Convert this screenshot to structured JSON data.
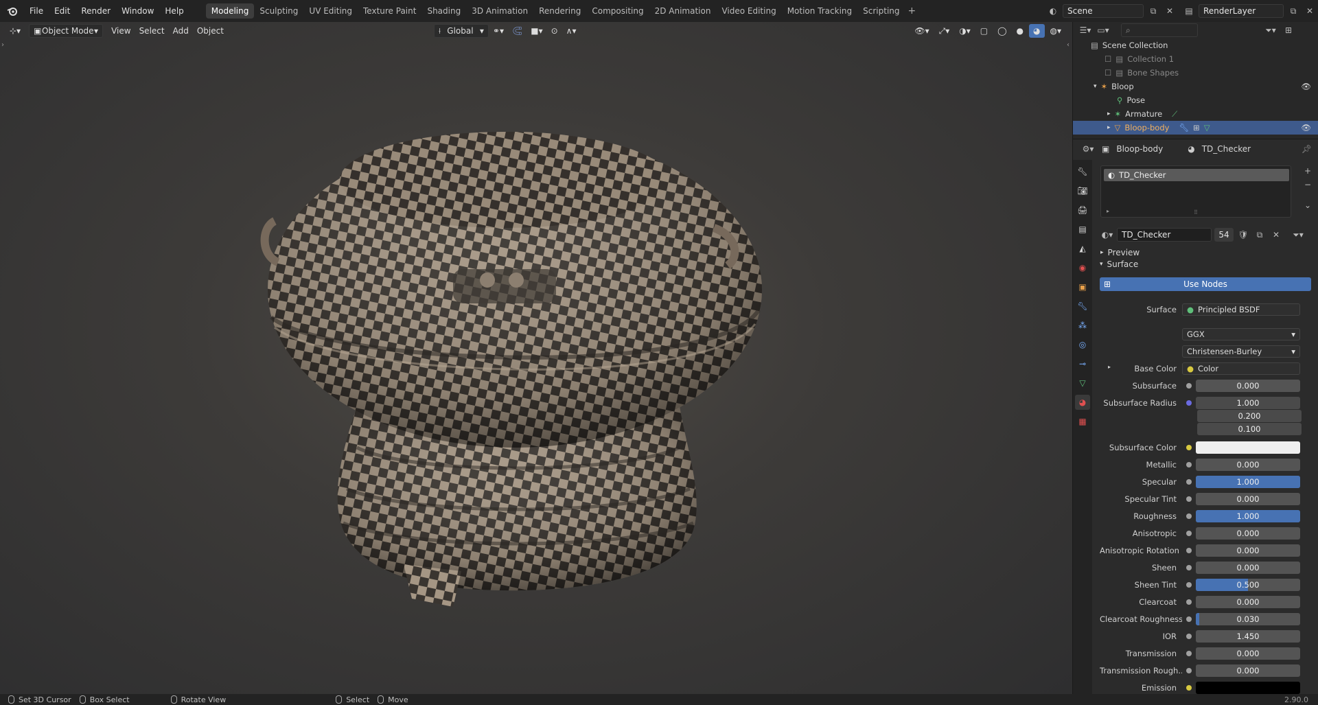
{
  "menu": [
    "File",
    "Edit",
    "Render",
    "Window",
    "Help"
  ],
  "workspaces": [
    "Modeling",
    "Sculpting",
    "UV Editing",
    "Texture Paint",
    "Shading",
    "3D Animation",
    "Rendering",
    "Compositing",
    "2D Animation",
    "Video Editing",
    "Motion Tracking",
    "Scripting"
  ],
  "active_workspace": "Modeling",
  "scene_name": "Scene",
  "view_layer": "RenderLayer",
  "viewport": {
    "mode": "Object Mode",
    "menus": [
      "View",
      "Select",
      "Add",
      "Object"
    ],
    "transform_orientation": "Global"
  },
  "outliner": {
    "root": "Scene Collection",
    "items": [
      {
        "label": "Collection 1"
      },
      {
        "label": "Bone Shapes"
      },
      {
        "label": "Bloop"
      },
      {
        "label": "Pose"
      },
      {
        "label": "Armature"
      },
      {
        "label": "Bloop-body"
      }
    ]
  },
  "properties": {
    "object_name": "Bloop-body",
    "material_name": "TD_Checker",
    "slot": "TD_Checker",
    "material_field": "TD_Checker",
    "users": "54",
    "preview_label": "Preview",
    "surface_label": "Surface",
    "use_nodes": "Use Nodes",
    "surface_row_label": "Surface",
    "surface_shader": "Principled BSDF",
    "distribution": "GGX",
    "subsurface_method": "Christensen-Burley",
    "base_color_label": "Base Color",
    "base_color_value": "Color",
    "subsurface_radius_label": "Subsurface Radius",
    "subsurface_radius": [
      "1.000",
      "0.200",
      "0.100"
    ],
    "subsurface_color_label": "Subsurface Color",
    "emission_label": "Emission",
    "params": [
      {
        "label": "Subsurface",
        "value": "0.000",
        "fill": 0
      },
      {
        "label": "Metallic",
        "value": "0.000",
        "fill": 0
      },
      {
        "label": "Specular",
        "value": "1.000",
        "fill": 1
      },
      {
        "label": "Specular Tint",
        "value": "0.000",
        "fill": 0
      },
      {
        "label": "Roughness",
        "value": "1.000",
        "fill": 1
      },
      {
        "label": "Anisotropic",
        "value": "0.000",
        "fill": 0
      },
      {
        "label": "Anisotropic Rotation",
        "value": "0.000",
        "fill": 0
      },
      {
        "label": "Sheen",
        "value": "0.000",
        "fill": 0
      },
      {
        "label": "Sheen Tint",
        "value": "0.500",
        "fill": 0.5
      },
      {
        "label": "Clearcoat",
        "value": "0.000",
        "fill": 0
      },
      {
        "label": "Clearcoat Roughness",
        "value": "0.030",
        "fill": 0.03
      },
      {
        "label": "IOR",
        "value": "1.450",
        "fill": 0
      },
      {
        "label": "Transmission",
        "value": "0.000",
        "fill": 0
      },
      {
        "label": "Transmission Rough...",
        "value": "0.000",
        "fill": 0
      }
    ]
  },
  "statusbar": {
    "items": [
      "Set 3D Cursor",
      "Box Select",
      "Rotate View",
      "Select",
      "Move"
    ],
    "version": "2.90.0"
  },
  "colors": {
    "accent": "#4772b3",
    "selected_row": "#3e5a8c",
    "orange": "#e8a04a"
  }
}
